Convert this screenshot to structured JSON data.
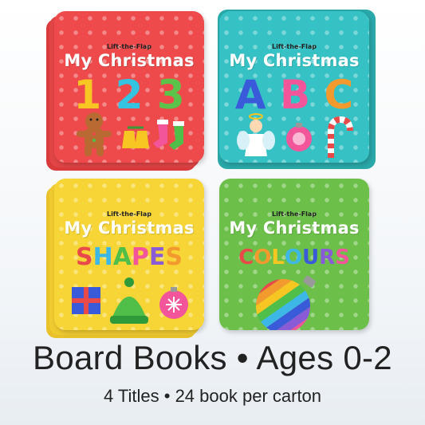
{
  "books": [
    {
      "lift": "Lift-the-Flap",
      "title": "My Christmas",
      "big": [
        "1",
        "2",
        "3"
      ],
      "bg": "#ee4a4b",
      "edge": "#d93b3c",
      "big_colors": [
        "#f7c623",
        "#34c3e0",
        "#5cc34a"
      ]
    },
    {
      "lift": "Lift-the-Flap",
      "title": "My Christmas",
      "big": [
        "A",
        "B",
        "C"
      ],
      "bg": "#36c2c4",
      "edge": "#2aa9ab",
      "big_colors": [
        "#3a5bd9",
        "#f2559a",
        "#f29a2e"
      ]
    },
    {
      "lift": "Lift-the-Flap",
      "title": "My Christmas",
      "big": [
        "S",
        "H",
        "A",
        "P",
        "E",
        "S"
      ],
      "bg": "#f7d536",
      "edge": "#e8c12b",
      "big_colors": [
        "#e84a4a",
        "#3db7e6",
        "#4fbf4a",
        "#f2559a",
        "#8a5bd6",
        "#f29a2e"
      ]
    },
    {
      "lift": "Lift-the-Flap",
      "title": "My Christmas",
      "big": [
        "C",
        "O",
        "L",
        "O",
        "U",
        "R",
        "S"
      ],
      "bg": "#6cc04a",
      "edge": "#5aab3c",
      "big_colors": [
        "#e84a4a",
        "#f29a2e",
        "#f7c623",
        "#3db7e6",
        "#3a5bd9",
        "#8a5bd6",
        "#f2559a"
      ]
    }
  ],
  "caption": {
    "main": "Board Books • Ages 0-2",
    "sub": "4 Titles • 24 book per carton"
  }
}
